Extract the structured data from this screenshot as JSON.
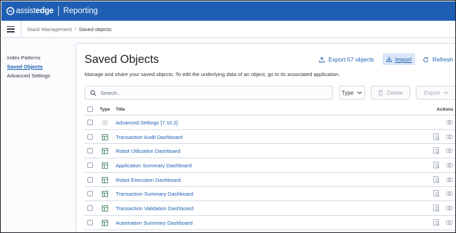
{
  "brand": {
    "name_light": "assist",
    "name_bold": "edge",
    "app": "Reporting"
  },
  "breadcrumb": {
    "parent": "Stack Management",
    "current": "Saved objects"
  },
  "sidenav": {
    "items": [
      {
        "label": "Index Patterns"
      },
      {
        "label": "Saved Objects"
      },
      {
        "label": "Advanced Settings"
      }
    ]
  },
  "page": {
    "title": "Saved Objects",
    "description": "Manage and share your saved objects. To edit the underlying data of an object, go to its associated application.",
    "export_label": "Export 57 objects",
    "import_label": "Import",
    "refresh_label": "Refresh"
  },
  "toolbar": {
    "search_placeholder": "Search...",
    "type_label": "Type",
    "delete_label": "Delete",
    "export_label": "Export"
  },
  "table": {
    "headers": {
      "type": "Type",
      "title": "Title",
      "actions": "Actions"
    },
    "rows": [
      {
        "title": "Advanced Settings [7.10.2]",
        "type_icon": "settings-icon"
      },
      {
        "title": "Transaction Audit Dashboard",
        "type_icon": "dashboard-icon"
      },
      {
        "title": "Robot Utilization Dashboard",
        "type_icon": "dashboard-icon"
      },
      {
        "title": "Application Summary Dashboard",
        "type_icon": "dashboard-icon"
      },
      {
        "title": "Robot Execution Dashboard",
        "type_icon": "dashboard-icon"
      },
      {
        "title": "Transaction Summary Dashboard",
        "type_icon": "dashboard-icon"
      },
      {
        "title": "Transaction Validation Dashboard",
        "type_icon": "dashboard-icon"
      },
      {
        "title": "Automation Summary Dashboard",
        "type_icon": "dashboard-icon"
      }
    ]
  },
  "colors": {
    "brand_bar": "#1f5fb3",
    "link": "#1f5fb3",
    "border": "#d3dae6"
  }
}
